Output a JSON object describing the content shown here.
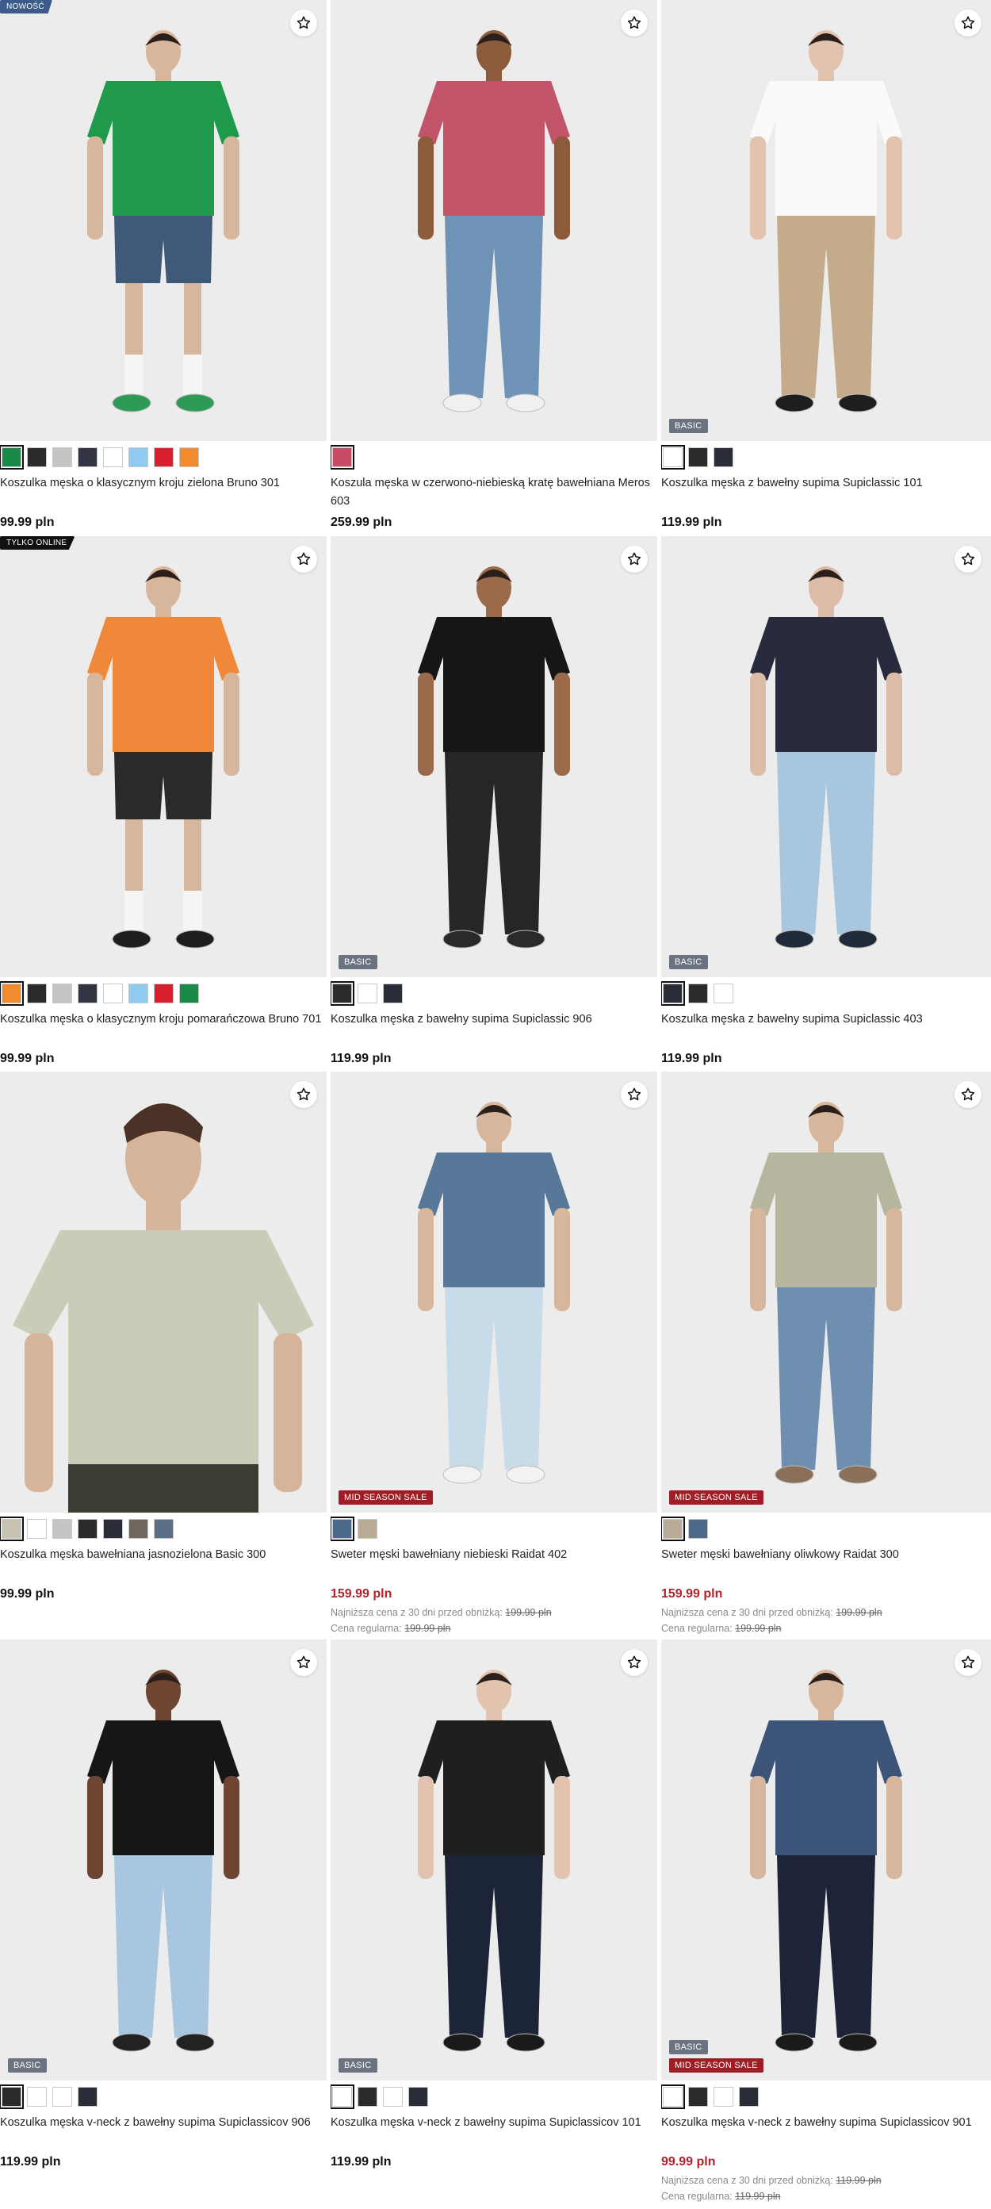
{
  "products": [
    {
      "name": "Koszulka męska o klasycznym kroju zielona Bruno 301",
      "price": "99.99 pln",
      "top_badge": "NOWOŚĆ",
      "top_badge_kind": "nowosc",
      "badges": [],
      "skin": "#d8b69c",
      "top_color": "#1e9a4a",
      "bottom_color": "#3e5a78",
      "bottom_kind": "shorts",
      "shoe_color": "#2d9b55",
      "bg": "#ececec",
      "swatches": [
        "#1a8a48",
        "#2b2b2b",
        "#c2c4c6",
        "#323443",
        "#ffffff",
        "#8fcaf0",
        "#d91f2e",
        "#f28a2e"
      ]
    },
    {
      "name": "Koszula męska w czerwono-niebieską kratę bawełniana Meros 603",
      "price": "259.99 pln",
      "badges": [],
      "skin": "#8c5b3c",
      "top_color": "#c2546a",
      "bottom_color": "#6f93b7",
      "bottom_kind": "pants",
      "shoe_color": "#f0f0f0",
      "bg": "#ececec",
      "swatches": [
        "#c84b63"
      ]
    },
    {
      "name": "Koszulka męska z bawełny supima Supiclassic 101",
      "price": "119.99 pln",
      "badges": [
        "BASIC"
      ],
      "skin": "#e2c3b0",
      "top_color": "#fafafa",
      "bottom_color": "#c4ab8c",
      "bottom_kind": "pants",
      "shoe_color": "#1e1e1e",
      "bg": "#ececec",
      "swatches": [
        "#ffffff",
        "#2b2b2b",
        "#2a2c38"
      ]
    },
    {
      "name": "Koszulka męska o klasycznym kroju pomarańczowa Bruno 701",
      "price": "99.99 pln",
      "top_badge": "TYLKO ONLINE",
      "top_badge_kind": "online",
      "badges": [],
      "skin": "#d8b69c",
      "top_color": "#f0883a",
      "bottom_color": "#2a2a2a",
      "bottom_kind": "shorts",
      "shoe_color": "#1e1e1e",
      "bg": "#ececec",
      "swatches": [
        "#f28a2e",
        "#2b2b2b",
        "#c2c4c6",
        "#323443",
        "#ffffff",
        "#8fcaf0",
        "#d91f2e",
        "#1a8a48"
      ]
    },
    {
      "name": "Koszulka męska z bawełny supima Supiclassic 906",
      "price": "119.99 pln",
      "badges": [
        "BASIC"
      ],
      "skin": "#9b6a4a",
      "top_color": "#161616",
      "bottom_color": "#262626",
      "bottom_kind": "pants",
      "shoe_color": "#2a2a2a",
      "bg": "#ececec",
      "swatches": [
        "#2b2b2b",
        "#ffffff",
        "#2a2c38"
      ]
    },
    {
      "name": "Koszulka męska z bawełny supima Supiclassic 403",
      "price": "119.99 pln",
      "badges": [
        "BASIC"
      ],
      "skin": "#dcbca6",
      "top_color": "#272b3d",
      "bottom_color": "#a8c6de",
      "bottom_kind": "pants",
      "shoe_color": "#1f2a3a",
      "bg": "#ececec",
      "swatches": [
        "#2a2c38",
        "#2b2b2b",
        "#ffffff"
      ]
    },
    {
      "name": "Koszulka męska bawełniana jasnozielona Basic 300",
      "price": "99.99 pln",
      "badges": [],
      "skin": "#d5b49a",
      "top_color": "#c9ccb6",
      "bottom_color": "#3a3d32",
      "bottom_kind": "closeup",
      "shoe_color": "#333333",
      "bg": "#ececec",
      "swatches": [
        "#c8c2b2",
        "#ffffff",
        "#c2c4c6",
        "#2b2b2b",
        "#2a2c38",
        "#6f6660",
        "#5a6e86"
      ]
    },
    {
      "name": "Sweter męski bawełniany niebieski Raidat 402",
      "price": "159.99 pln",
      "price_kind": "sale",
      "lowest_label": "Najniższa cena z 30 dni przed obniżką:",
      "lowest_price": "199.99 pln",
      "regular_label": "Cena regularna:",
      "regular_price": "199.99 pln",
      "badges": [
        "MID SEASON SALE"
      ],
      "skin": "#d8b69c",
      "top_color": "#58789a",
      "bottom_color": "#c8dbe8",
      "bottom_kind": "pants",
      "shoe_color": "#f2f2f2",
      "bg": "#ececec",
      "swatches": [
        "#4e6a8a",
        "#b8ac98"
      ]
    },
    {
      "name": "Sweter męski bawełniany oliwkowy Raidat 300",
      "price": "159.99 pln",
      "price_kind": "sale",
      "lowest_label": "Najniższa cena z 30 dni przed obniżką:",
      "lowest_price": "199.99 pln",
      "regular_label": "Cena regularna:",
      "regular_price": "199.99 pln",
      "badges": [
        "MID SEASON SALE"
      ],
      "skin": "#d8b69c",
      "top_color": "#b6b59e",
      "bottom_color": "#6f8fb0",
      "bottom_kind": "pants",
      "shoe_color": "#8a7058",
      "bg": "#ececec",
      "swatches": [
        "#b8ac98",
        "#4e6a8a"
      ]
    },
    {
      "name": "Koszulka męska v-neck z bawełny supima Supiclassicov 906",
      "price": "119.99 pln",
      "badges": [
        "BASIC"
      ],
      "skin": "#6e4530",
      "top_color": "#161616",
      "bottom_color": "#a9c6e0",
      "bottom_kind": "pants",
      "shoe_color": "#222222",
      "bg": "#ececec",
      "swatches": [
        "#2b2b2b",
        "#ffffff",
        "#ffffff",
        "#2a2c38"
      ]
    },
    {
      "name": "Koszulka męska v-neck z bawełny supima Supiclassicov 101",
      "price": "119.99 pln",
      "badges": [
        "BASIC"
      ],
      "skin": "#e2c3b0",
      "top_color": "#1f1f1f",
      "bottom_color": "#1c2438",
      "bottom_kind": "pants",
      "shoe_color": "#1a1a1a",
      "bg": "#ececec",
      "swatches": [
        "#ffffff",
        "#2b2b2b",
        "#ffffff",
        "#2a2c38"
      ]
    },
    {
      "name": "Koszulka męska v-neck z bawełny supima Supiclassicov 901",
      "price": "99.99 pln",
      "price_kind": "sale",
      "lowest_label": "Najniższa cena z 30 dni przed obniżką:",
      "lowest_price": "119.99 pln",
      "regular_label": "Cena regularna:",
      "regular_price": "119.99 pln",
      "badges": [
        "BASIC",
        "MID SEASON SALE"
      ],
      "skin": "#d8b69c",
      "top_color": "#3b5478",
      "bottom_color": "#1d2438",
      "bottom_kind": "pants",
      "shoe_color": "#1a1a1a",
      "bg": "#ececec",
      "swatches": [
        "#ffffff",
        "#2b2b2b",
        "#ffffff",
        "#2a2c38"
      ]
    }
  ],
  "icons": {
    "favorite": "star-outline-icon"
  }
}
